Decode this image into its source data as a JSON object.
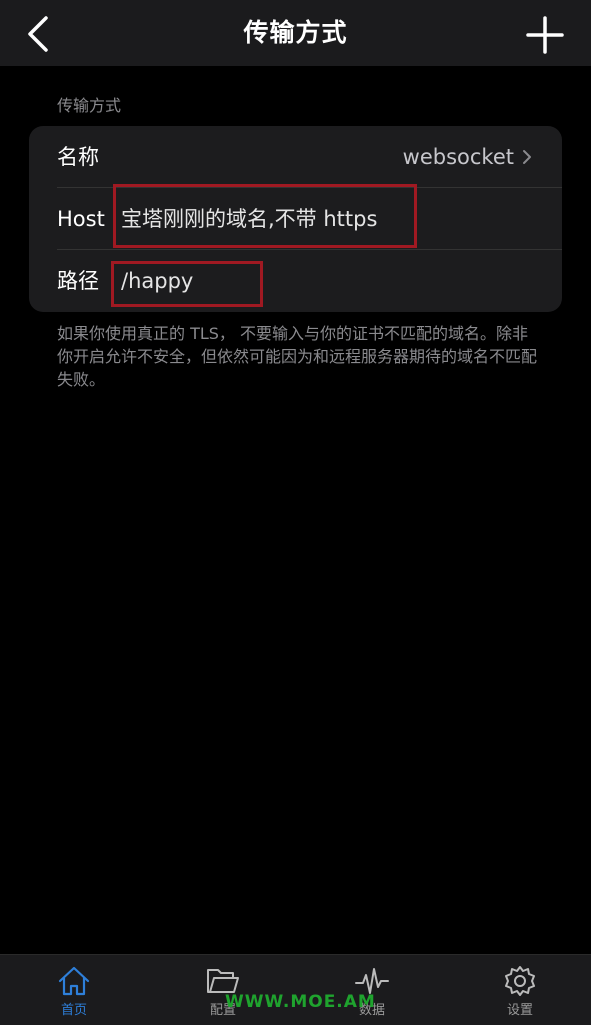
{
  "nav": {
    "title": "传输方式",
    "back_icon": "chevron-left-icon",
    "add_icon": "plus-icon"
  },
  "section": {
    "header": "传输方式",
    "rows": {
      "name": {
        "label": "名称",
        "value": "websocket"
      },
      "host": {
        "label": "Host",
        "value": "宝塔刚刚的域名,不带 https"
      },
      "path": {
        "label": "路径",
        "value": "/happy"
      }
    },
    "footer": "如果你使用真正的 TLS， 不要输入与你的证书不匹配的域名。除非你开启允许不安全，但依然可能因为和远程服务器期待的域名不匹配失败。"
  },
  "tabs": [
    {
      "label": "首页",
      "icon": "home-icon",
      "active": true
    },
    {
      "label": "配置",
      "icon": "folder-icon",
      "active": false
    },
    {
      "label": "数据",
      "icon": "activity-icon",
      "active": false
    },
    {
      "label": "设置",
      "icon": "gear-icon",
      "active": false
    }
  ],
  "watermark": "WWW.MOE.AM",
  "colors": {
    "background": "#000000",
    "bar": "#1b1b1d",
    "card": "#1c1c1e",
    "accent": "#2e7fd9",
    "highlight_box": "#a01922",
    "watermark": "#1fa32e"
  }
}
